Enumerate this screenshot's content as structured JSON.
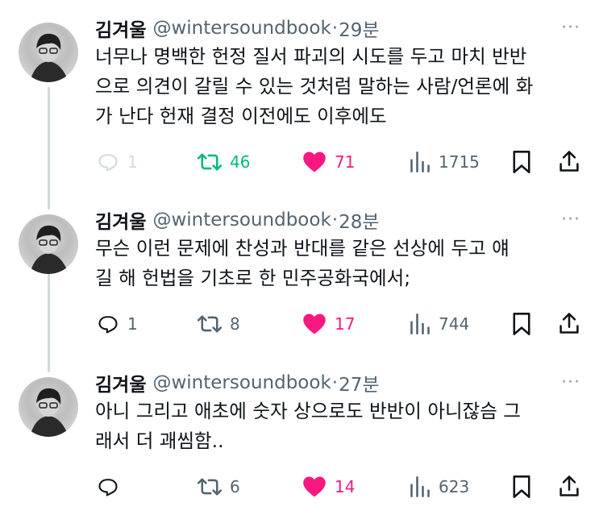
{
  "tweets": [
    {
      "name": "김겨울",
      "handle": "@wintersoundbook",
      "sep": "·",
      "time": "29분",
      "more": "···",
      "text": "너무나 명백한 헌정 질서 파괴의 시도를 두고 마치 반반\n으로 의견이 갈릴 수 있는 것처럼 말하는 사람/언론에 화\n가 난다 헌재 결정 이전에도 이후에도",
      "replies": "1",
      "retweets": "46",
      "likes": "71",
      "views": "1715",
      "retweeted": true,
      "liked": true,
      "reply_faded": true
    },
    {
      "name": "김겨울",
      "handle": "@wintersoundbook",
      "sep": "·",
      "time": "28분",
      "more": "···",
      "text": "무슨 이런 문제에 찬성과 반대를 같은 선상에 두고 얘\n길 해 헌법을 기초로 한 민주공화국에서;",
      "replies": "1",
      "retweets": "8",
      "likes": "17",
      "views": "744",
      "retweeted": false,
      "liked": true,
      "reply_faded": false
    },
    {
      "name": "김겨울",
      "handle": "@wintersoundbook",
      "sep": "·",
      "time": "27분",
      "more": "···",
      "text": "아니 그리고 애초에 숫자 상으로도 반반이 아니잖슴 그\n래서 더 괘씸함..",
      "replies": "",
      "retweets": "6",
      "likes": "14",
      "views": "623",
      "retweeted": false,
      "liked": true,
      "reply_faded": false
    }
  ],
  "colors": {
    "retweet_green": "#00ba7c",
    "like_pink": "#f91880",
    "muted": "#536471",
    "faded": "#cfd9de"
  },
  "icons": [
    "reply-icon",
    "retweet-icon",
    "heart-icon",
    "views-icon",
    "bookmark-icon",
    "share-icon"
  ]
}
